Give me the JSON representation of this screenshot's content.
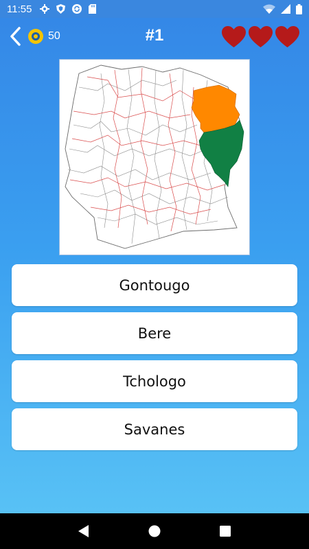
{
  "status_bar": {
    "time": "11:55",
    "icons_left": [
      "gear-icon",
      "shield-icon",
      "sync-icon",
      "sdcard-icon"
    ],
    "icons_right": [
      "wifi-icon",
      "cellular-icon",
      "battery-icon"
    ]
  },
  "header": {
    "back_icon": "chevron-left-icon",
    "coins": "50",
    "question_number": "#1",
    "lives": 3,
    "heart_color": "#b51a1a"
  },
  "map": {
    "description_icon": "region-map",
    "highlight_colors": [
      "#ff8800",
      "#118044"
    ]
  },
  "answers": [
    {
      "label": "Gontougo"
    },
    {
      "label": "Bere"
    },
    {
      "label": "Tchologo"
    },
    {
      "label": "Savanes"
    }
  ],
  "nav_bar": {
    "back_icon": "triangle-back-icon",
    "home_icon": "circle-home-icon",
    "recents_icon": "square-recents-icon"
  }
}
